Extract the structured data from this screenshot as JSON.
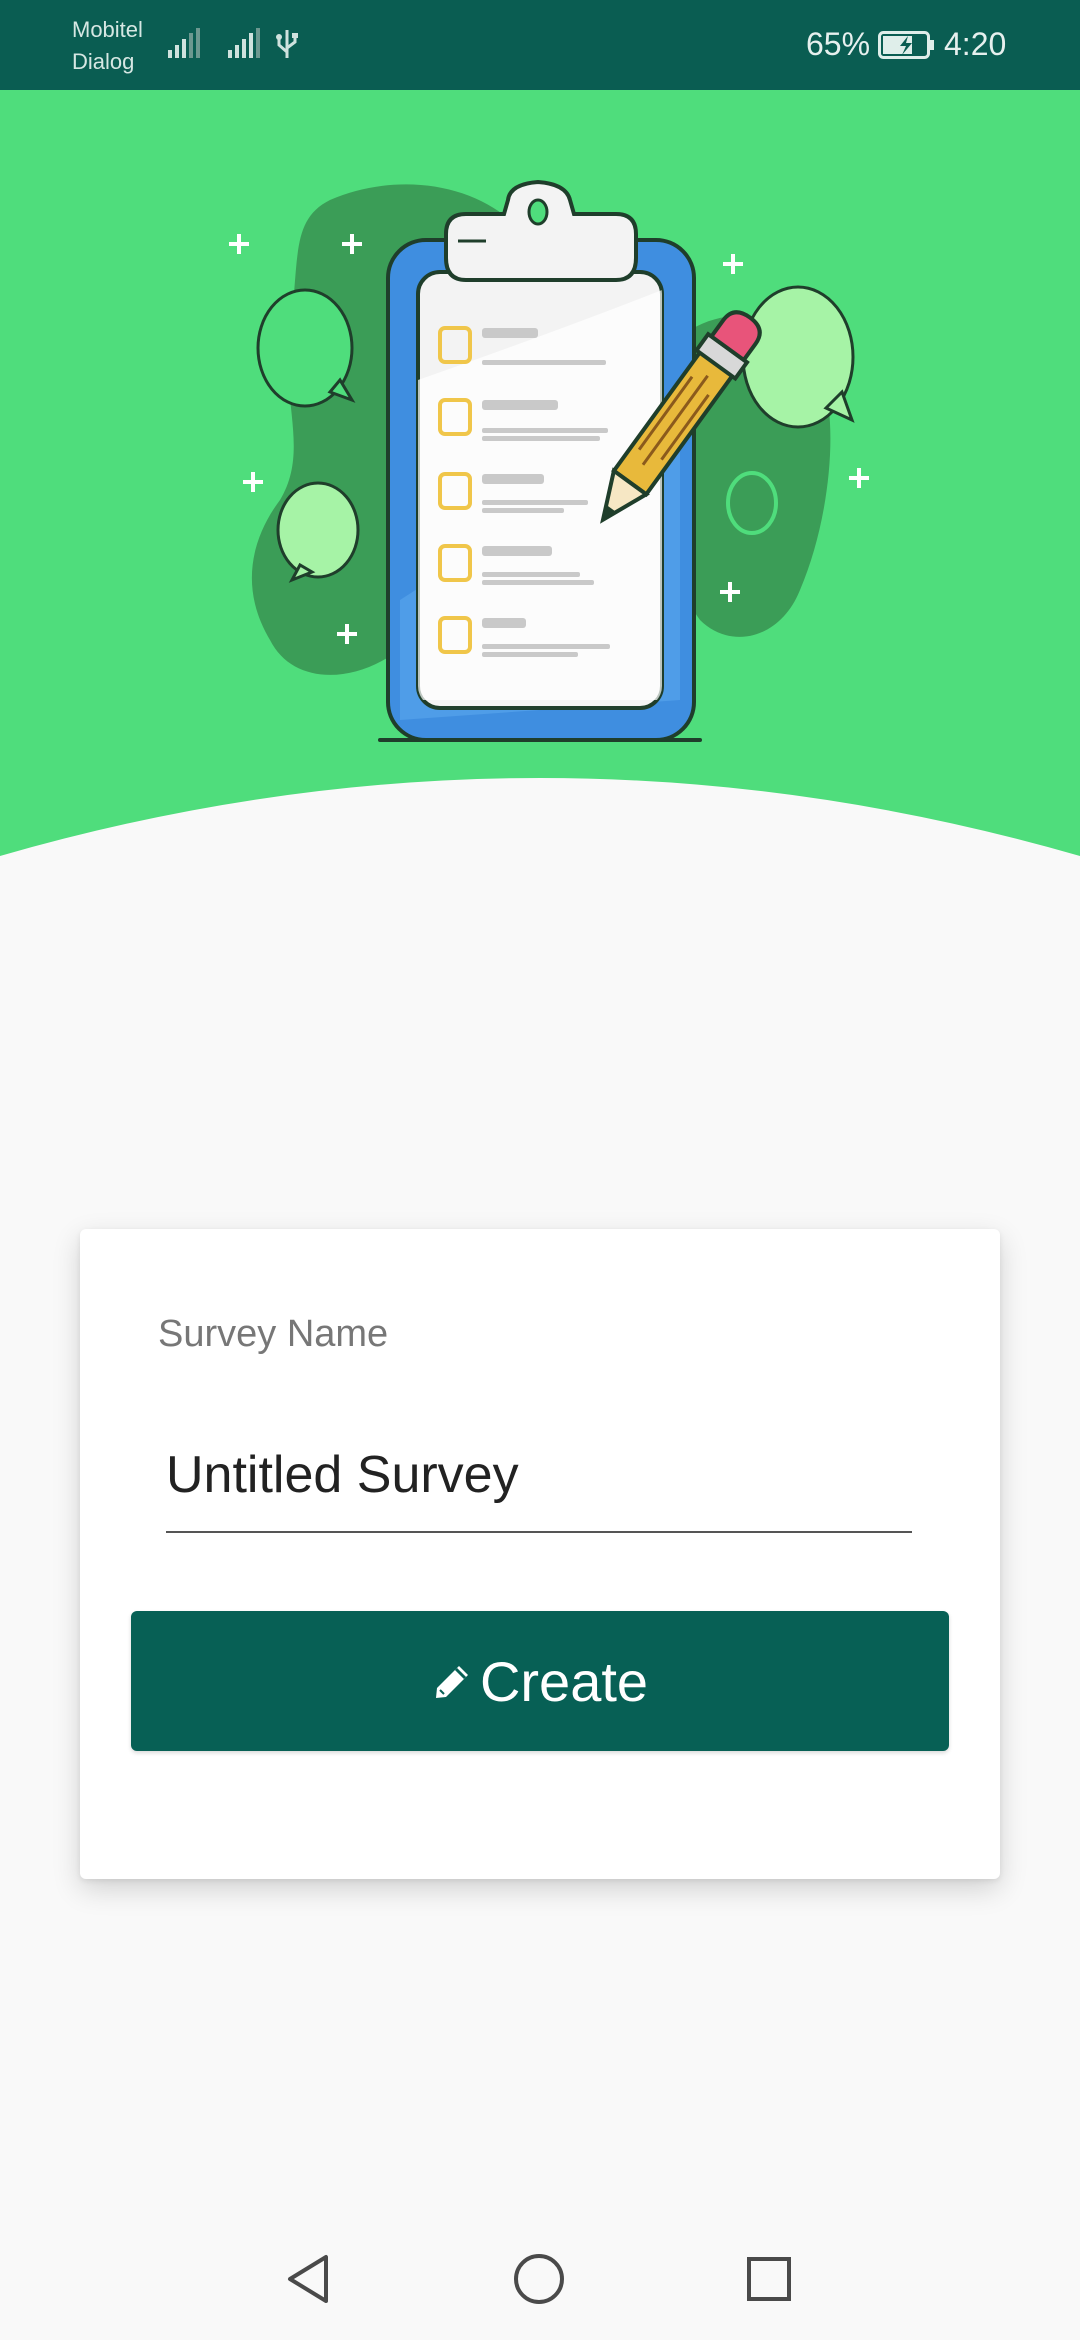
{
  "status_bar": {
    "carrier_1": "Mobitel",
    "carrier_2": "Dialog",
    "battery_percent": "65%",
    "time": "4:20",
    "icons": [
      "signal-icon",
      "signal-icon",
      "usb-icon",
      "battery-charging-icon"
    ]
  },
  "hero": {
    "illustration": "clipboard-checklist-with-pencil",
    "colors": {
      "background": "#4fdd7c",
      "blob": "#3b9d57",
      "clipboard": "#3f8ee0",
      "pencil": "#e8b93b",
      "eraser": "#e8547a"
    }
  },
  "form": {
    "label": "Survey Name",
    "input_value": "Untitled Survey",
    "button_label": "Create",
    "button_icon": "pencil-icon",
    "colors": {
      "button": "#076055",
      "status_bar": "#0a5d52"
    }
  },
  "nav": {
    "icons": [
      "back-icon",
      "home-icon",
      "recents-icon"
    ]
  }
}
